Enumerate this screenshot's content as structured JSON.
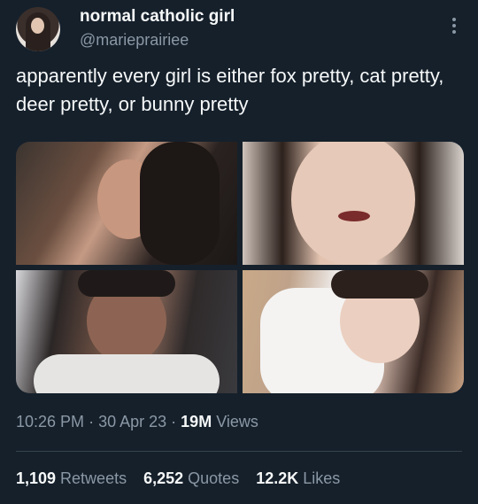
{
  "author": {
    "name": "normal catholic girl",
    "handle": "@marieprairiee"
  },
  "tweet": {
    "text": "apparently every girl is either fox pretty, cat pretty, deer pretty, or bunny pretty"
  },
  "meta": {
    "time": "10:26 PM",
    "date": "30 Apr 23",
    "views_count": "19M",
    "views_label": "Views",
    "separator": "·"
  },
  "stats": [
    {
      "count": "1,109",
      "label": "Retweets"
    },
    {
      "count": "6,252",
      "label": "Quotes"
    },
    {
      "count": "12.2K",
      "label": "Likes"
    }
  ],
  "icons": {
    "more": "more-options-icon"
  },
  "colors": {
    "background": "#15202b",
    "primary_text": "#f7f9f9",
    "secondary_text": "#8b98a5",
    "divider": "#38444d"
  }
}
